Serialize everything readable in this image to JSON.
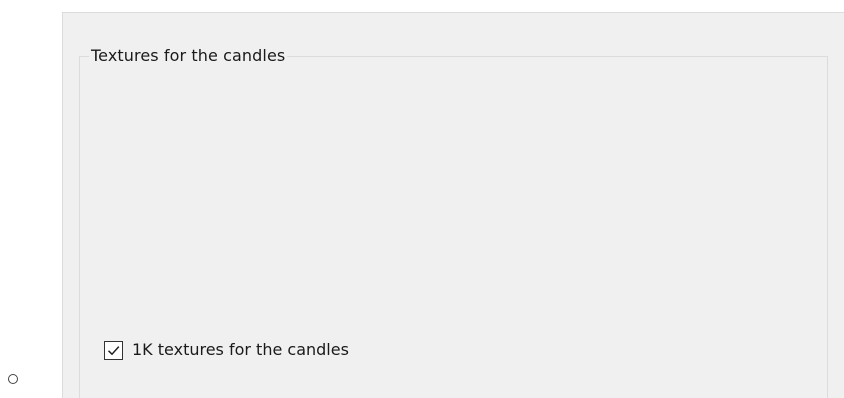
{
  "dialog": {
    "groupbox": {
      "title": "Textures for the candles"
    },
    "checkbox": {
      "label": "1K textures for the candles",
      "checked": true
    }
  },
  "icons": {
    "bullet": "radio-bullet-icon",
    "check": "checkmark-icon"
  }
}
